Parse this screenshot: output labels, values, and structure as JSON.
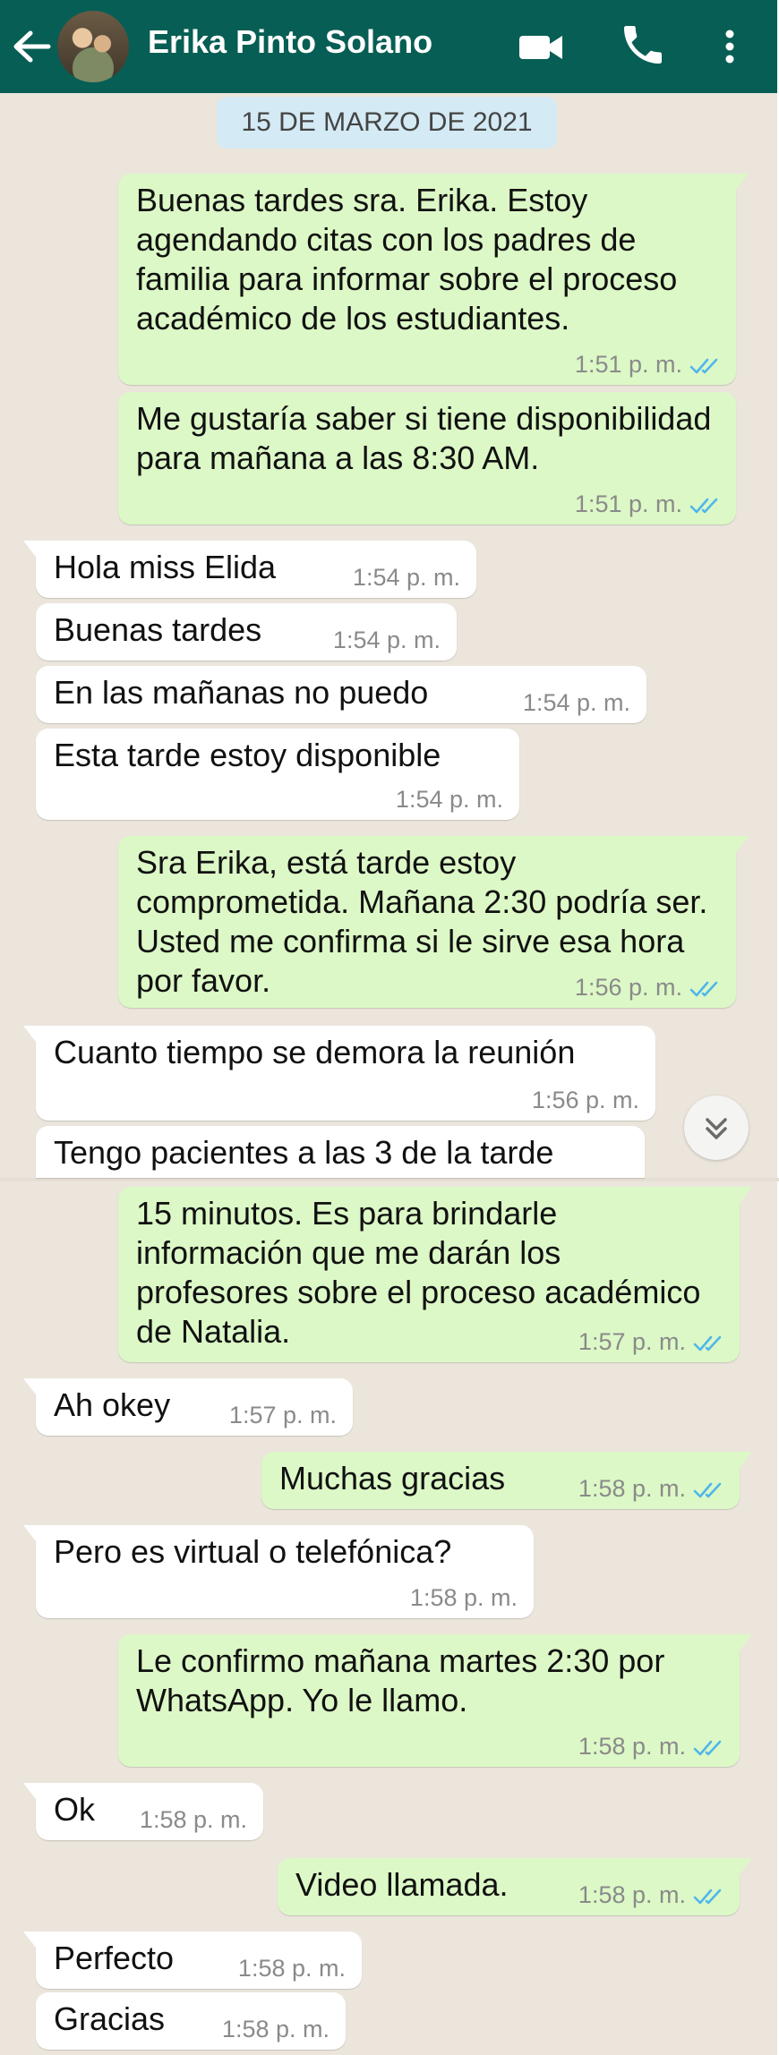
{
  "header": {
    "contact_name": "Erika Pinto Solano",
    "color": "#075e54"
  },
  "chat": {
    "date_label": "15 DE MARZO DE 2021",
    "outgoing_color": "#dcf8c6",
    "incoming_color": "#ffffff",
    "read_check_color": "#4fb6ec",
    "messages": [
      {
        "direction": "out",
        "text": "Buenas tardes sra. Erika. Estoy agendando citas con los padres de familia para informar sobre el proceso académico de los estudiantes.",
        "time": "1:51 p. m.",
        "status": "read"
      },
      {
        "direction": "out",
        "text": "Me gustaría saber si tiene disponibilidad para mañana a las 8:30 AM.",
        "time": "1:51 p. m.",
        "status": "read"
      },
      {
        "direction": "in",
        "text": "Hola miss Elida",
        "time": "1:54 p. m."
      },
      {
        "direction": "in",
        "text": "Buenas tardes",
        "time": "1:54 p. m."
      },
      {
        "direction": "in",
        "text": "En las mañanas no puedo",
        "time": "1:54 p. m."
      },
      {
        "direction": "in",
        "text": "Esta tarde estoy disponible",
        "time": "1:54 p. m."
      },
      {
        "direction": "out",
        "text": "Sra Erika, está tarde estoy comprometida. Mañana 2:30 podría ser. Usted me confirma si le sirve esa hora por favor.",
        "time": "1:56 p. m.",
        "status": "read"
      },
      {
        "direction": "in",
        "text": "Cuanto tiempo se demora la reunión",
        "time": "1:56 p. m."
      },
      {
        "direction": "in",
        "text": "Tengo pacientes a las 3 de la tarde",
        "time": ""
      },
      {
        "direction": "out",
        "text": "15 minutos. Es para brindarle información que me darán los profesores sobre el proceso académico de Natalia.",
        "time": "1:57 p. m.",
        "status": "read"
      },
      {
        "direction": "in",
        "text": "Ah okey",
        "time": "1:57 p. m."
      },
      {
        "direction": "out",
        "text": "Muchas gracias",
        "time": "1:58 p. m.",
        "status": "read"
      },
      {
        "direction": "in",
        "text": "Pero es virtual o telefónica?",
        "time": "1:58 p. m."
      },
      {
        "direction": "out",
        "text": "Le confirmo mañana martes 2:30 por WhatsApp. Yo le llamo.",
        "time": "1:58 p. m.",
        "status": "read"
      },
      {
        "direction": "in",
        "text": "Ok",
        "time": "1:58 p. m."
      },
      {
        "direction": "out",
        "text": "Video llamada.",
        "time": "1:58 p. m.",
        "status": "read"
      },
      {
        "direction": "in",
        "text": "Perfecto",
        "time": "1:58 p. m."
      },
      {
        "direction": "in",
        "text": "Gracias",
        "time": "1:58 p. m."
      }
    ]
  },
  "icons": {
    "back": "back-arrow-icon",
    "video": "video-camera-icon",
    "call": "phone-icon",
    "menu": "more-vertical-icon",
    "scroll": "double-chevron-down-icon",
    "read": "double-check-icon"
  }
}
